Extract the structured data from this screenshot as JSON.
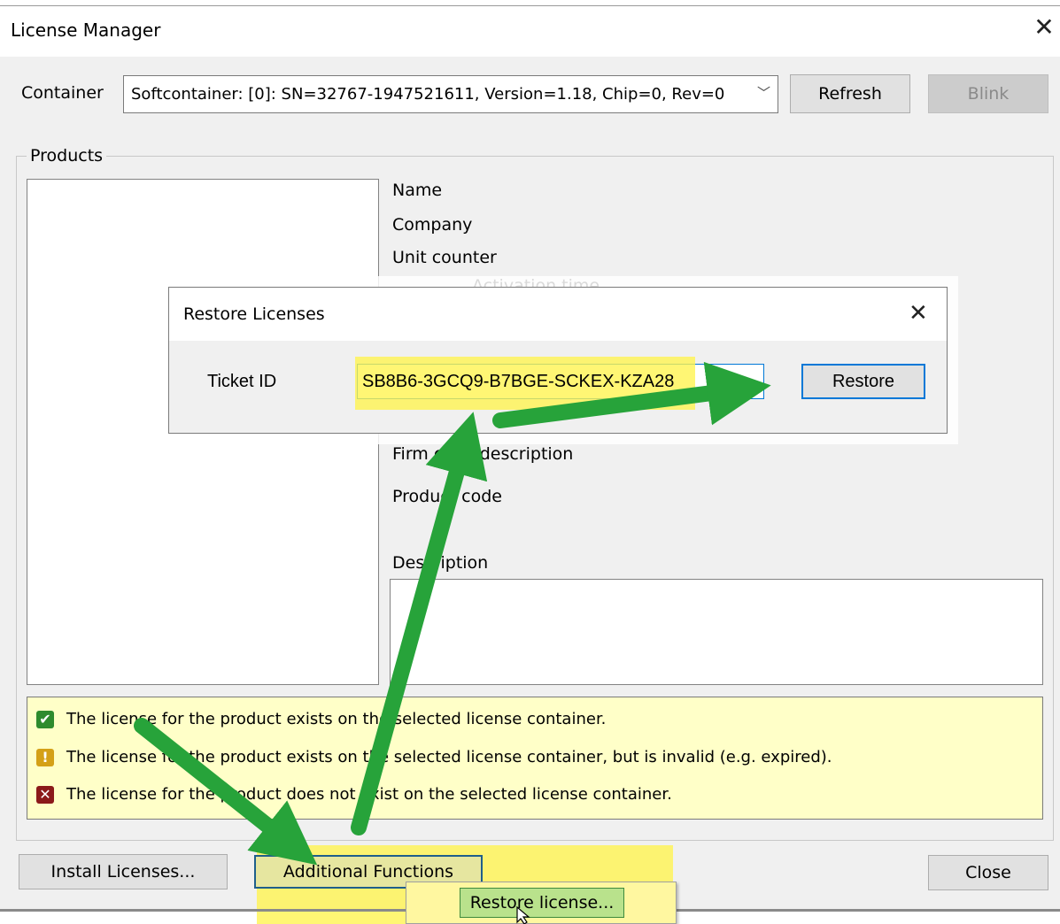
{
  "window": {
    "title": "License Manager",
    "close_symbol": "✕"
  },
  "container": {
    "label": "Container",
    "selected": "Softcontainer: [0]: SN=32767-1947521611, Version=1.18, Chip=0, Rev=0",
    "refresh_label": "Refresh",
    "blink_label": "Blink"
  },
  "products": {
    "group_label": "Products",
    "fields": [
      "Name",
      "Company",
      "Unit counter",
      "Activation time",
      "Firm code description",
      "Product code"
    ],
    "description_label": "Description"
  },
  "legend": [
    {
      "icon": "check-icon",
      "symbol": "✔",
      "color": "#2e8b2e",
      "text": "The license for the product exists on the selected license container."
    },
    {
      "icon": "warning-icon",
      "symbol": "!",
      "color": "#d4a017",
      "text": "The license for the product exists on the selected license container, but is invalid (e.g. expired)."
    },
    {
      "icon": "error-icon",
      "symbol": "✕",
      "color": "#8b1a1a",
      "text": "The license for the product does not exist on the selected license container."
    }
  ],
  "buttons": {
    "install": "Install Licenses...",
    "additional": "Additional Functions",
    "close": "Close"
  },
  "menu": {
    "restore_item": "Restore license..."
  },
  "dialog": {
    "title": "Restore Licenses",
    "close_symbol": "✕",
    "ticket_label": "Ticket ID",
    "ticket_value": "SB8B6-3GCQ9-B7BGE-SCKEX-KZA28",
    "restore_label": "Restore"
  },
  "colors": {
    "highlight": "#fff34d",
    "arrow": "#27a33a",
    "focus_border": "#0078d7"
  }
}
